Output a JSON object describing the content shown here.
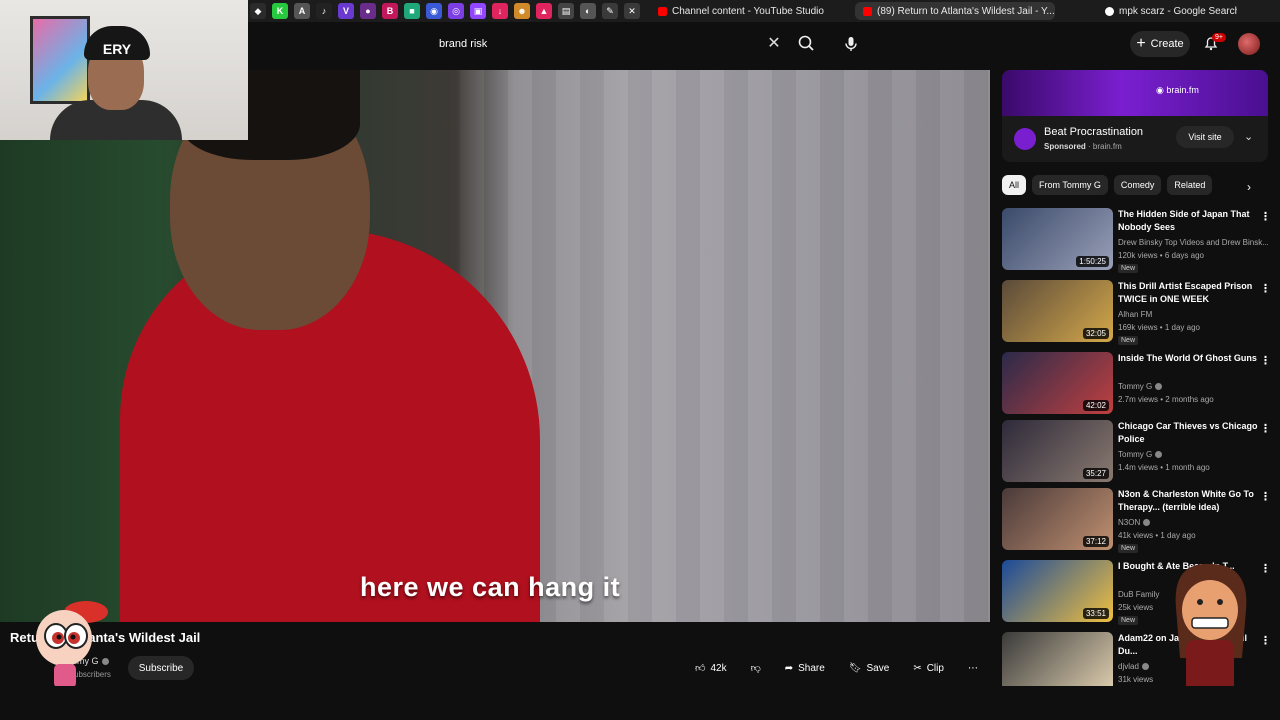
{
  "browser": {
    "tabs": [
      {
        "label": "Channel content - YouTube Studio",
        "fav_color": "#ff0000",
        "active": false
      },
      {
        "label": "(89) Return to Atlanta's Wildest Jail - Y...",
        "fav_color": "#ff0000",
        "active": true
      },
      {
        "label": "mpk scarz - Google Search",
        "fav_color": "#ffffff",
        "active": false
      }
    ],
    "pinned": [
      {
        "icon": "notion-icon",
        "glyph": "◆",
        "color": "#2b2b2b"
      },
      {
        "icon": "kick-icon",
        "glyph": "K",
        "color": "#27c93f"
      },
      {
        "icon": "a-app-icon",
        "glyph": "A",
        "color": "#555555"
      },
      {
        "icon": "tiktok-icon",
        "glyph": "♪",
        "color": "#222222"
      },
      {
        "icon": "v-app-icon",
        "glyph": "V",
        "color": "#6a3ad0"
      },
      {
        "icon": "app-icon",
        "glyph": "●",
        "color": "#6a2c8a"
      },
      {
        "icon": "b-app-icon",
        "glyph": "B",
        "color": "#c2185b"
      },
      {
        "icon": "app-icon",
        "glyph": "■",
        "color": "#1fa97a"
      },
      {
        "icon": "app-icon",
        "glyph": "◉",
        "color": "#3b5bd6"
      },
      {
        "icon": "app-icon",
        "glyph": "◎",
        "color": "#7b3fe4"
      },
      {
        "icon": "twitch-icon",
        "glyph": "▣",
        "color": "#9146ff"
      },
      {
        "icon": "download-icon",
        "glyph": "↓",
        "color": "#e0245e"
      },
      {
        "icon": "app-icon",
        "glyph": "☻",
        "color": "#d18a2a"
      },
      {
        "icon": "app-icon",
        "glyph": "▲",
        "color": "#e0245e"
      },
      {
        "icon": "clipboard-icon",
        "glyph": "▤",
        "color": "#444444"
      },
      {
        "icon": "app-icon",
        "glyph": "◐",
        "color": "#555555"
      },
      {
        "icon": "app-icon",
        "glyph": "✎",
        "color": "#3a3a3a"
      },
      {
        "icon": "app-icon",
        "glyph": "✕",
        "color": "#3a3a3a"
      }
    ]
  },
  "header": {
    "search_value": "brand risk",
    "create_label": "Create",
    "notif_badge": "9+"
  },
  "video": {
    "subtitle": "here we can hang it",
    "title": "Return to Atlanta's Wildest Jail",
    "channel": "Tommy G",
    "subscribers": "subscribers",
    "subscribe_label": "Subscribe"
  },
  "actions": {
    "likes": "42k",
    "share": "Share",
    "save": "Save",
    "clip": "Clip"
  },
  "ad": {
    "banner_text": "brain.fm",
    "title": "Beat Procrastination",
    "sponsored": "Sponsored",
    "domain": "brain.fm",
    "visit_label": "Visit site"
  },
  "chips": [
    "All",
    "From Tommy G",
    "Comedy",
    "Related"
  ],
  "recommendations": [
    {
      "title": "The Hidden Side of Japan That Nobody Sees",
      "channel": "Drew Binsky Top Videos and Drew Binsk...",
      "verified": false,
      "views": "120k views",
      "age": "6 days ago",
      "badge": "New",
      "duration": "1:50:25",
      "thumb": "#3a4a6a",
      "thumb2": "#9aa0b8"
    },
    {
      "title": "This Drill Artist Escaped Prison TWICE in ONE WEEK",
      "channel": "Alhan FM",
      "verified": false,
      "views": "169k views",
      "age": "1 day ago",
      "badge": "New",
      "duration": "32:05",
      "thumb": "#5a4a3a",
      "thumb2": "#d4a84a"
    },
    {
      "title": "Inside The World Of Ghost Guns",
      "channel": "Tommy G",
      "verified": true,
      "views": "2.7m views",
      "age": "2 months ago",
      "badge": "",
      "duration": "42:02",
      "thumb": "#2a2a4a",
      "thumb2": "#c04040"
    },
    {
      "title": "Chicago Car Thieves vs Chicago Police",
      "channel": "Tommy G",
      "verified": true,
      "views": "1.4m views",
      "age": "1 month ago",
      "badge": "",
      "duration": "35:27",
      "thumb": "#2e2a3a",
      "thumb2": "#8a7a70"
    },
    {
      "title": "N3on & Charleston White Go To Therapy... (terrible idea)",
      "channel": "N3ON",
      "verified": true,
      "views": "41k views",
      "age": "1 day ago",
      "badge": "New",
      "duration": "37:12",
      "thumb": "#4a3a3a",
      "thumb2": "#c09070"
    },
    {
      "title": "I Bought & Ate Beans In T...",
      "channel": "DuB Family",
      "verified": false,
      "views": "25k views",
      "age": "",
      "badge": "New",
      "duration": "33:51",
      "thumb": "#1a4a9a",
      "thumb2": "#f0c040"
    },
    {
      "title": "Adam22 on Jas... Blueface, Lil Du...",
      "channel": "djvlad",
      "verified": true,
      "views": "31k views",
      "age": "",
      "badge": "",
      "duration": "",
      "thumb": "#3a3a3a",
      "thumb2": "#e0d0b0"
    }
  ],
  "colors": {
    "accent_red": "#cc0000",
    "ad_purple": "#7a1fd0",
    "bg": "#0f0f0f"
  }
}
